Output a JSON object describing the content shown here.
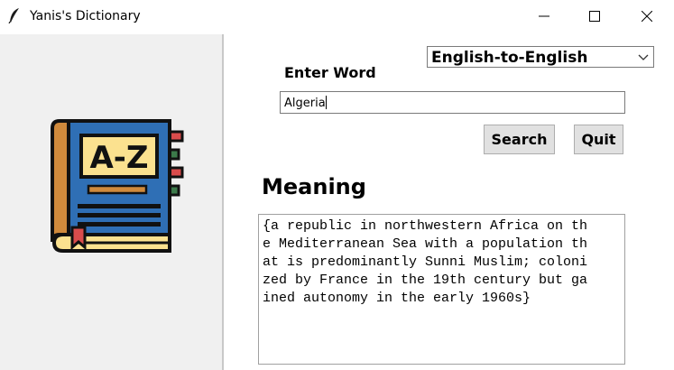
{
  "window": {
    "title": "Yanis's Dictionary",
    "icon": "feather-icon",
    "controls": [
      "minimize-icon",
      "maximize-icon",
      "close-icon"
    ]
  },
  "sidebar": {
    "illustration": "dictionary-book-icon",
    "illustration_text": "A-Z"
  },
  "dictionary": {
    "mode_selected": "English-to-English",
    "enter_label": "Enter Word",
    "word_value": "Algeria",
    "search_label": "Search",
    "quit_label": "Quit",
    "meaning_label": "Meaning",
    "meaning_lines": [
      "{a republic in northwestern Africa on th",
      "e Mediterranean Sea with a population th",
      "at is predominantly Sunni Muslim; coloni",
      "zed by France in the 19th century but ga",
      "ined autonomy in the early 1960s}"
    ]
  },
  "colors": {
    "book_cover": "#2f6fb5",
    "book_spine": "#d08a3c",
    "label_plate": "#fbe18f",
    "tab_red": "#d94c4c",
    "tab_green": "#3c7a4a"
  }
}
